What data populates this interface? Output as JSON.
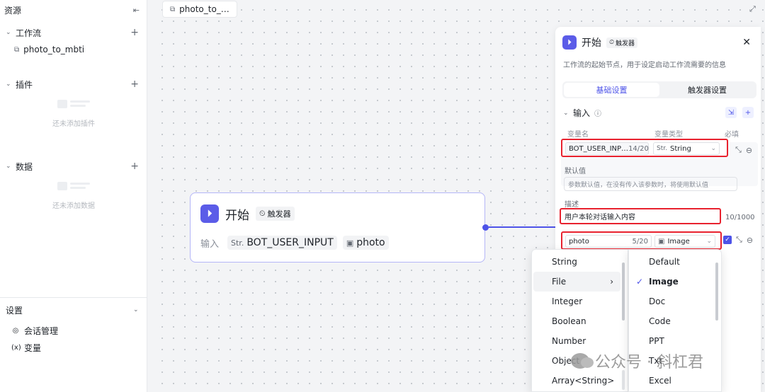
{
  "sidebar": {
    "title": "资源",
    "workflow": {
      "label": "工作流",
      "items": [
        "photo_to_mbti"
      ]
    },
    "plugins": {
      "label": "插件",
      "empty_text": "还未添加插件"
    },
    "data": {
      "label": "数据",
      "empty_text": "还未添加数据"
    },
    "settings": {
      "label": "设置",
      "items": [
        {
          "icon": "session-icon",
          "label": "会话管理"
        },
        {
          "icon": "variable-icon",
          "label": "变量"
        }
      ]
    }
  },
  "tab": {
    "label": "photo_to_…"
  },
  "node": {
    "title": "开始",
    "trigger_badge": "触发器",
    "inputs_label": "输入",
    "inputs": [
      {
        "type_icon": "Str.",
        "name": "BOT_USER_INPUT"
      },
      {
        "type_icon": "image-icon",
        "name": "photo"
      }
    ]
  },
  "panel": {
    "title": "开始",
    "trigger_badge": "触发器",
    "description": "工作流的起始节点，用于设定启动工作流需要的信息",
    "tabs": [
      "基础设置",
      "触发器设置"
    ],
    "active_tab": 0,
    "input_label": "输入",
    "columns": {
      "name": "变量名",
      "type": "变量类型",
      "required": "必填"
    },
    "var1": {
      "name": "BOT_USER_INP…",
      "count": "14/20",
      "type_prefix": "Str.",
      "type": "String"
    },
    "default_label": "默认值",
    "default_placeholder": "参数默认值，在没有传入该参数时，将使用默认值",
    "desc_label": "描述",
    "desc_value": "用户本轮对话输入内容",
    "desc_count": "10/1000",
    "var2": {
      "name": "photo",
      "count": "5/20",
      "type": "Image"
    }
  },
  "type_menu": {
    "items": [
      "String",
      "File",
      "Integer",
      "Boolean",
      "Number",
      "Object",
      "Array<String>"
    ],
    "selected": "File"
  },
  "file_menu": {
    "items": [
      "Default",
      "Image",
      "Doc",
      "Code",
      "PPT",
      "Txt",
      "Excel"
    ],
    "selected": "Image"
  },
  "watermark": {
    "text": "公众号 · 斜杠君"
  },
  "colors": {
    "accent": "#4d53e8",
    "highlight": "#e8222f"
  }
}
